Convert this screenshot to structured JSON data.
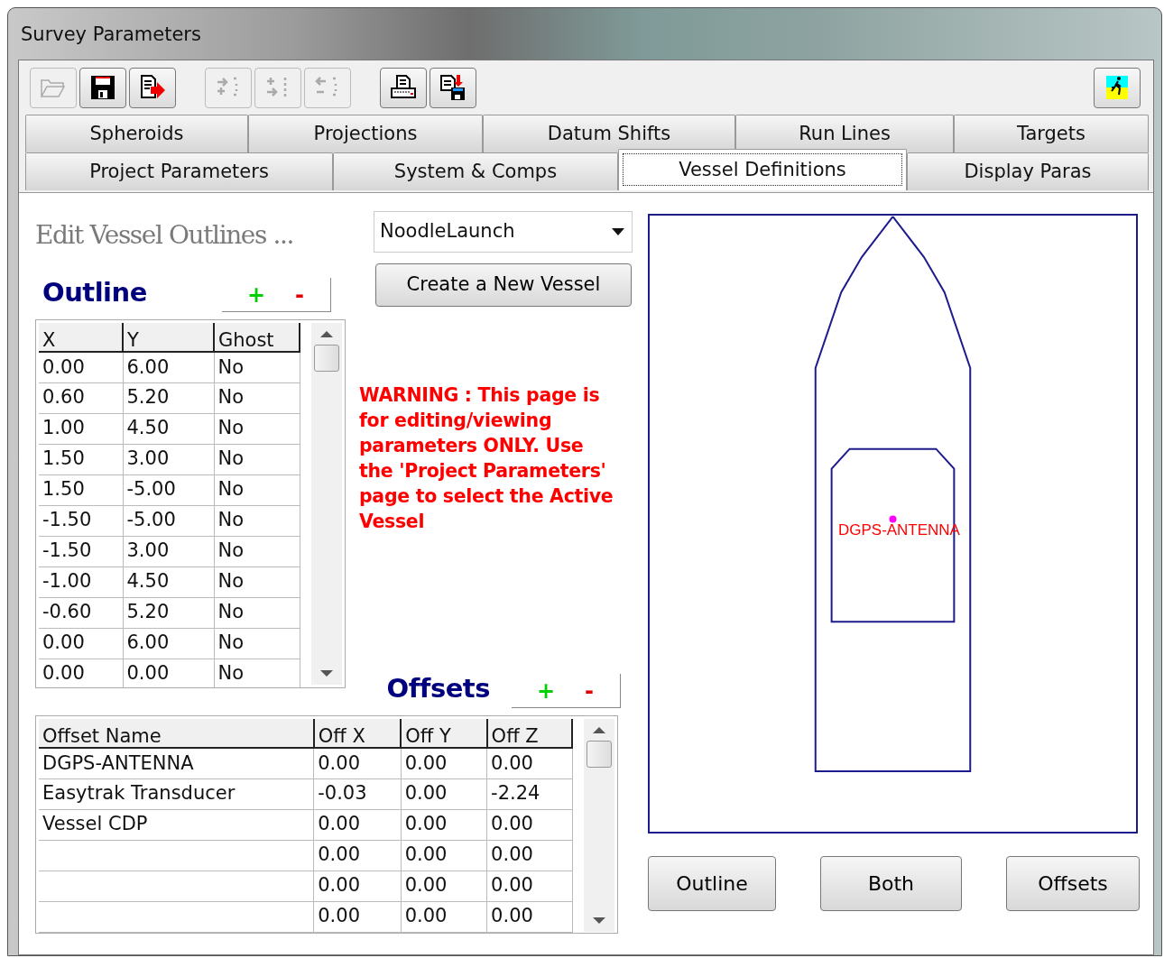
{
  "window": {
    "title": "Survey Parameters"
  },
  "toolbar": [
    {
      "kind": "open",
      "disabled": true
    },
    {
      "kind": "save",
      "disabled": false
    },
    {
      "kind": "export",
      "disabled": false
    },
    {
      "kind": "insert",
      "disabled": true
    },
    {
      "kind": "append",
      "disabled": true
    },
    {
      "kind": "remove",
      "disabled": true
    },
    {
      "kind": "print",
      "disabled": false
    },
    {
      "kind": "print-save",
      "disabled": false
    },
    {
      "kind": "exit",
      "disabled": false
    }
  ],
  "tab_rows": [
    {
      "tabs": [
        {
          "label": "Spheroids",
          "selected": false
        },
        {
          "label": "Projections",
          "selected": false
        },
        {
          "label": "Datum Shifts",
          "selected": false
        },
        {
          "label": "Run Lines",
          "selected": false
        },
        {
          "label": "Targets",
          "selected": false
        }
      ]
    },
    {
      "tabs": [
        {
          "label": "Project Parameters",
          "selected": false
        },
        {
          "label": "System & Comps",
          "selected": false
        },
        {
          "label": "Vessel Definitions",
          "selected": true
        },
        {
          "label": "Display Paras",
          "selected": false
        }
      ]
    }
  ],
  "heading": "Edit Vessel Outlines ...",
  "vessel_select": {
    "value": "NoodleLaunch"
  },
  "create_button": "Create a New Vessel",
  "outline": {
    "title": "Outline",
    "add": "+",
    "remove": "-",
    "columns": [
      "X",
      "Y",
      "Ghost"
    ],
    "rows": [
      [
        "0.00",
        "6.00",
        "No"
      ],
      [
        "0.60",
        "5.20",
        "No"
      ],
      [
        "1.00",
        "4.50",
        "No"
      ],
      [
        "1.50",
        "3.00",
        "No"
      ],
      [
        "1.50",
        "-5.00",
        "No"
      ],
      [
        "-1.50",
        "-5.00",
        "No"
      ],
      [
        "-1.50",
        "3.00",
        "No"
      ],
      [
        "-1.00",
        "4.50",
        "No"
      ],
      [
        "-0.60",
        "5.20",
        "No"
      ],
      [
        "0.00",
        "6.00",
        "No"
      ],
      [
        "0.00",
        "0.00",
        "No"
      ]
    ]
  },
  "warning": "WARNING : This page is for editing/viewing parameters ONLY. Use the 'Project Parameters' page to select the Active Vessel",
  "offsets": {
    "title": "Offsets",
    "add": "+",
    "remove": "-",
    "columns": [
      "Offset Name",
      "Off X",
      "Off Y",
      "Off Z"
    ],
    "rows": [
      [
        "DGPS-ANTENNA",
        "0.00",
        "0.00",
        "0.00"
      ],
      [
        "Easytrak Transducer",
        "-0.03",
        "0.00",
        "-2.24"
      ],
      [
        "Vessel CDP",
        "0.00",
        "0.00",
        "0.00"
      ],
      [
        "",
        "0.00",
        "0.00",
        "0.00"
      ],
      [
        "",
        "0.00",
        "0.00",
        "0.00"
      ],
      [
        "",
        "0.00",
        "0.00",
        "0.00"
      ]
    ]
  },
  "vessel_view": {
    "offset_label": "DGPS-ANTENNA"
  },
  "view_buttons": [
    {
      "label": "Outline"
    },
    {
      "label": "Both"
    },
    {
      "label": "Offsets"
    }
  ]
}
